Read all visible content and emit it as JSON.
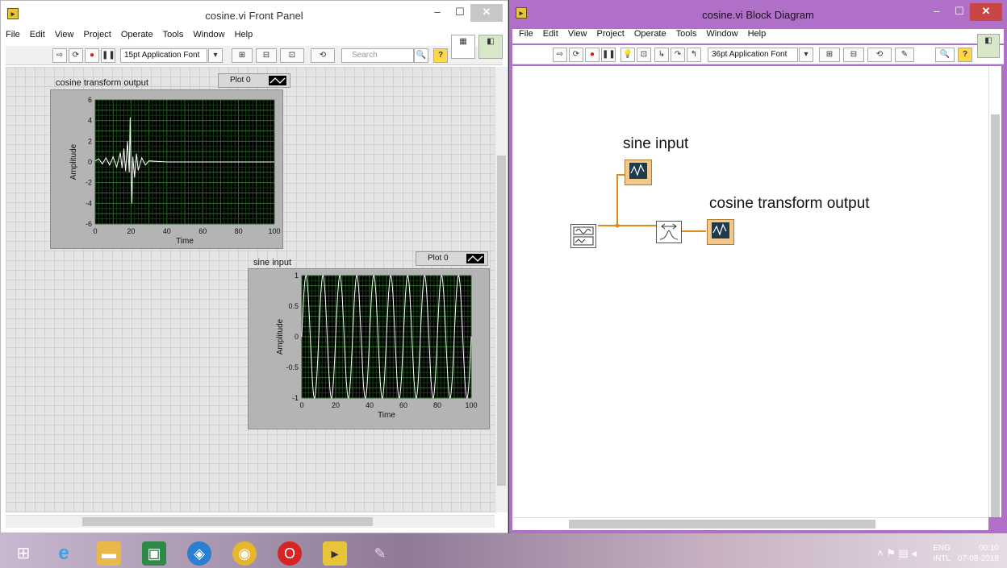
{
  "front_panel": {
    "title": "cosine.vi Front Panel",
    "menu": [
      "File",
      "Edit",
      "View",
      "Project",
      "Operate",
      "Tools",
      "Window",
      "Help"
    ],
    "font_selector": "15pt Application Font",
    "search_placeholder": "Search",
    "graph1": {
      "label": "cosine transform output",
      "legend": "Plot 0",
      "y_axis_label": "Amplitude",
      "x_axis_label": "Time",
      "y_ticks": [
        "6",
        "4",
        "2",
        "0",
        "-2",
        "-4",
        "-6"
      ],
      "x_ticks": [
        "0",
        "20",
        "40",
        "60",
        "80",
        "100"
      ]
    },
    "graph2": {
      "label": "sine input",
      "legend": "Plot 0",
      "y_axis_label": "Amplitude",
      "x_axis_label": "Time",
      "y_ticks": [
        "1",
        "0.5",
        "0",
        "-0.5",
        "-1"
      ],
      "x_ticks": [
        "0",
        "20",
        "40",
        "60",
        "80",
        "100"
      ]
    }
  },
  "block_diagram": {
    "title": "cosine.vi Block Diagram",
    "menu": [
      "File",
      "Edit",
      "View",
      "Project",
      "Operate",
      "Tools",
      "Window",
      "Help"
    ],
    "font_selector": "36pt Application Font",
    "label_sine": "sine input",
    "label_cosine": "cosine transform output"
  },
  "taskbar": {
    "lang_top": "ENG",
    "lang_bottom": "INTL",
    "time": "00:10",
    "date": "07-08-2018"
  },
  "colors": {
    "bd_accent": "#b070c8",
    "graph_bg": "#000000",
    "wire": "#e08a1e",
    "plot_line": "#ffffff"
  },
  "chart_data": [
    {
      "type": "line",
      "title": "cosine transform output",
      "xlabel": "Time",
      "ylabel": "Amplitude",
      "xlim": [
        0,
        100
      ],
      "ylim": [
        -6,
        6
      ],
      "grid": true,
      "series": [
        {
          "x": [
            0,
            2,
            4,
            6,
            8,
            10,
            12,
            14,
            15,
            16,
            17,
            18,
            19,
            19.5,
            20,
            20.5,
            21,
            22,
            23,
            24,
            26,
            28,
            30,
            35,
            40,
            50,
            100
          ],
          "values": [
            0.1,
            0.3,
            -0.2,
            0.4,
            -0.3,
            0.5,
            -0.5,
            0.9,
            -0.6,
            1.3,
            -0.9,
            2.0,
            -1.0,
            4.3,
            -0.8,
            -4.0,
            0.5,
            -1.5,
            0.8,
            -0.8,
            0.4,
            -0.3,
            0.1,
            0.05,
            0.0,
            0.0,
            0.0
          ]
        }
      ]
    },
    {
      "type": "line",
      "title": "sine input",
      "xlabel": "Time",
      "ylabel": "Amplitude",
      "xlim": [
        0,
        100
      ],
      "ylim": [
        -1,
        1
      ],
      "grid": true,
      "series": [
        {
          "function": "sin",
          "cycles": 10,
          "samples": 100
        }
      ]
    }
  ]
}
